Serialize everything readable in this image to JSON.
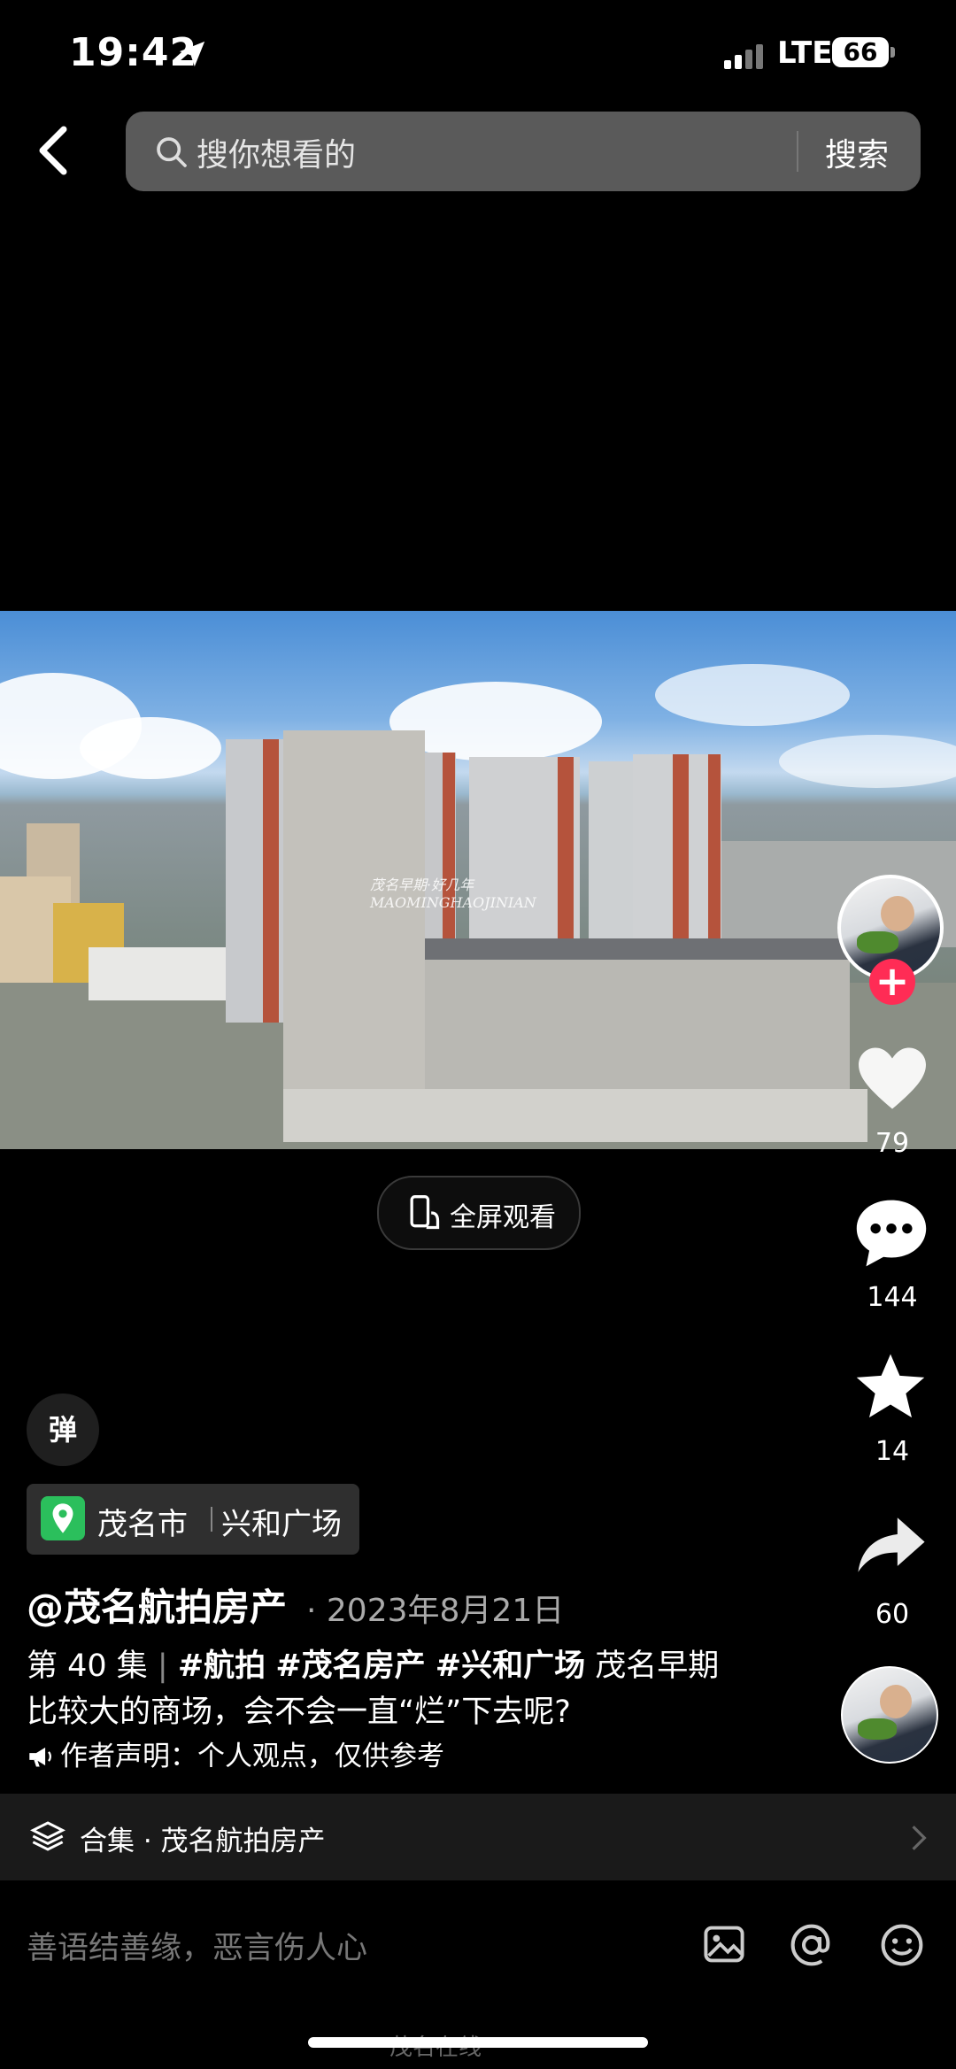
{
  "status_bar": {
    "time": "19:42",
    "network": "LTE",
    "battery": "66"
  },
  "search": {
    "placeholder": "搜你想看的",
    "submit_label": "搜索"
  },
  "video": {
    "watermark_cn": "茂名早期·好几年",
    "watermark_en": "MAOMINGHAOJINIAN"
  },
  "fullscreen": {
    "label": "全屏观看"
  },
  "actions": {
    "likes": "79",
    "comments": "144",
    "favorites": "14",
    "shares": "60"
  },
  "danmu": {
    "label": "弹"
  },
  "location": {
    "city": "茂名市",
    "place": "兴和广场"
  },
  "post": {
    "author": "@茂名航拍房产",
    "date": "· 2023年8月21日",
    "episode": "第 40 集",
    "tags": [
      "#航拍",
      "#茂名房产",
      "#兴和广场"
    ],
    "text_after_tags": "茂名早期",
    "text_line2": "比较大的商场，会不会一直“烂”下去呢?",
    "disclaimer": "作者声明：个人观点，仅供参考"
  },
  "collection": {
    "label": "合集 · 茂名航拍房产"
  },
  "comment": {
    "placeholder": "善语结善缘，恶言伤人心"
  },
  "footer": {
    "watermark": "茂名在线"
  },
  "colors": {
    "follow_red": "#ff2c55",
    "location_green": "#2bbf5c",
    "search_bg": "#5a5a5a"
  },
  "icons": [
    "location-arrow-icon",
    "back-icon",
    "search-icon",
    "fullscreen-icon",
    "heart-icon",
    "comment-icon",
    "star-icon",
    "share-icon",
    "map-pin-icon",
    "megaphone-icon",
    "layers-icon",
    "chevron-right-icon",
    "image-icon",
    "at-icon",
    "emoji-icon"
  ]
}
